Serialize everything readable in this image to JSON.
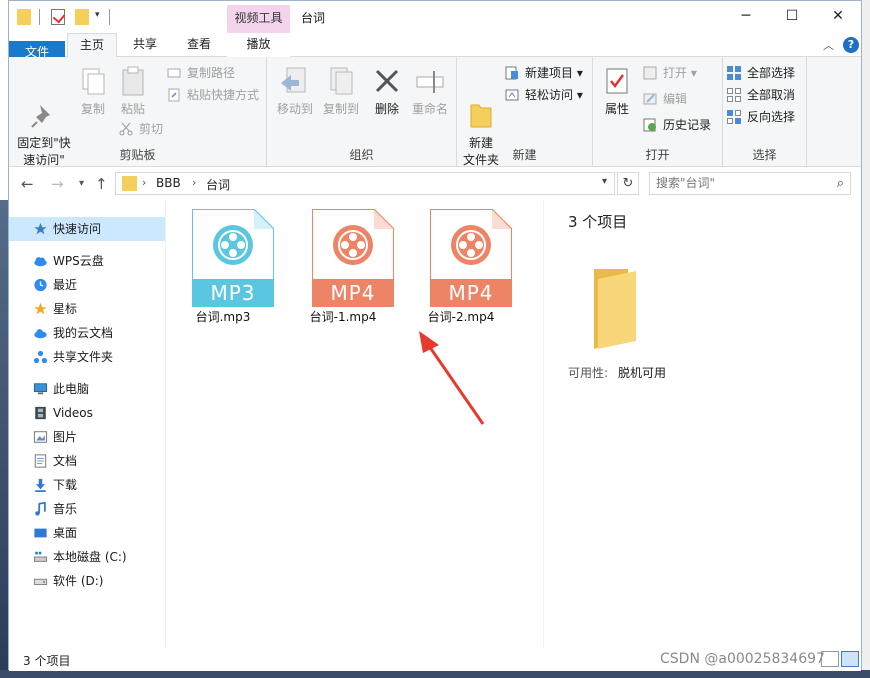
{
  "titlebar": {
    "context_tab": "视频工具",
    "title": "台词",
    "minimize": "─",
    "maximize": "☐",
    "close": "✕"
  },
  "tabs": {
    "file": "文件",
    "home": "主页",
    "share": "共享",
    "view": "查看",
    "play": "播放",
    "help": "?"
  },
  "ribbon": {
    "clipboard": {
      "label": "剪贴板",
      "pin": "固定到\"快\n速访问\"",
      "copy": "复制",
      "paste": "粘贴",
      "copy_path": "复制路径",
      "paste_shortcut": "粘贴快捷方式",
      "cut": "剪切"
    },
    "organize": {
      "label": "组织",
      "move_to": "移动到",
      "copy_to": "复制到",
      "delete": "删除",
      "rename": "重命名"
    },
    "new": {
      "label": "新建",
      "new_folder": "新建\n文件夹",
      "new_item": "新建项目",
      "easy_access": "轻松访问"
    },
    "open": {
      "label": "打开",
      "properties": "属性",
      "open": "打开",
      "edit": "编辑",
      "history": "历史记录"
    },
    "select": {
      "label": "选择",
      "select_all": "全部选择",
      "select_none": "全部取消",
      "invert": "反向选择"
    }
  },
  "address": {
    "path": [
      "BBB",
      "台词"
    ],
    "search_placeholder": "搜索\"台词\""
  },
  "sidebar": {
    "items": [
      {
        "label": "快速访问",
        "icon": "star-icon"
      },
      {
        "label": "WPS云盘",
        "icon": "cloud-icon"
      },
      {
        "label": "最近",
        "icon": "clock-icon"
      },
      {
        "label": "星标",
        "icon": "star-outline-icon"
      },
      {
        "label": "我的云文档",
        "icon": "cloud-doc-icon"
      },
      {
        "label": "共享文件夹",
        "icon": "share-icon"
      },
      {
        "label": "此电脑",
        "icon": "computer-icon"
      },
      {
        "label": "Videos",
        "icon": "video-folder-icon"
      },
      {
        "label": "图片",
        "icon": "pictures-icon"
      },
      {
        "label": "文档",
        "icon": "documents-icon"
      },
      {
        "label": "下载",
        "icon": "download-icon"
      },
      {
        "label": "音乐",
        "icon": "music-icon"
      },
      {
        "label": "桌面",
        "icon": "desktop-icon"
      },
      {
        "label": "本地磁盘 (C:)",
        "icon": "drive-c-icon"
      },
      {
        "label": "软件 (D:)",
        "icon": "drive-d-icon"
      }
    ]
  },
  "files": [
    {
      "name": "台词.mp3",
      "badge": "MP3",
      "color": "#5bc6e0"
    },
    {
      "name": "台词-1.mp4",
      "badge": "MP4",
      "color": "#ee8466"
    },
    {
      "name": "台词-2.mp4",
      "badge": "MP4",
      "color": "#ee8466"
    }
  ],
  "details": {
    "count": "3 个项目",
    "availability_label": "可用性:",
    "availability_value": "脱机可用"
  },
  "status": {
    "count": "3 个项目"
  },
  "watermark": "CSDN @a00025834697",
  "colors": {
    "accent": "#1979ca",
    "selection": "#cce8ff",
    "context_tab": "#f4d4ec",
    "annotation_arrow": "#e8392f"
  }
}
